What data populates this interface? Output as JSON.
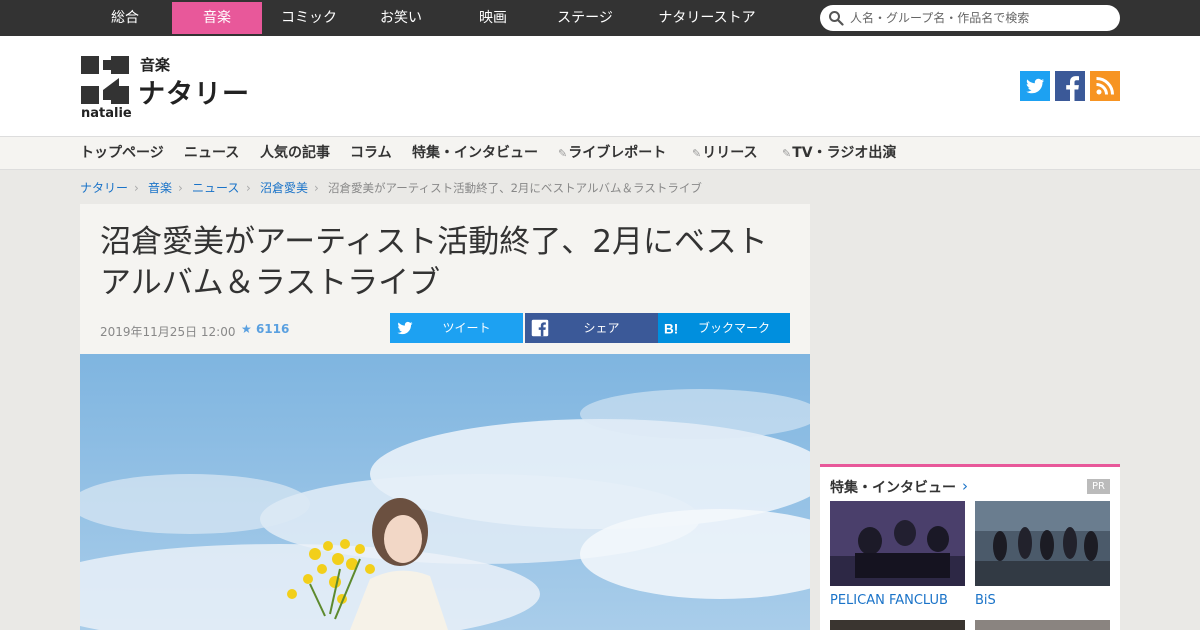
{
  "top_nav": {
    "categories": [
      {
        "label": "総合",
        "active": false
      },
      {
        "label": "音楽",
        "active": true
      },
      {
        "label": "コミック",
        "active": false
      },
      {
        "label": "お笑い",
        "active": false
      },
      {
        "label": "映画",
        "active": false
      },
      {
        "label": "ステージ",
        "active": false
      },
      {
        "label": "ナタリーストア",
        "active": false
      }
    ],
    "search_placeholder": "人名・グループ名・作品名で検索",
    "active_color": "#e8589a"
  },
  "header": {
    "logo_sub": "音楽",
    "logo_main": "ナタリー",
    "logo_en": "natalie",
    "social_icons": [
      "twitter-icon",
      "facebook-icon",
      "rss-icon"
    ]
  },
  "section_nav": {
    "items": [
      {
        "label": "トップページ",
        "pen": false
      },
      {
        "label": "ニュース",
        "pen": false
      },
      {
        "label": "人気の記事",
        "pen": false
      },
      {
        "label": "コラム",
        "pen": false
      },
      {
        "label": "特集・インタビュー",
        "pen": false
      },
      {
        "label": "ライブレポート",
        "pen": true
      },
      {
        "label": "リリース",
        "pen": true
      },
      {
        "label": "TV・ラジオ出演",
        "pen": true
      }
    ]
  },
  "breadcrumb": [
    "ナタリー",
    "音楽",
    "ニュース",
    "沼倉愛美",
    "沼倉愛美がアーティスト活動終了、2月にベストアルバム＆ラストライブ"
  ],
  "article": {
    "title": "沼倉愛美がアーティスト活動終了、2月にベストアルバム＆ラストライブ",
    "date": "2019年11月25日 12:00",
    "star_count": "6116",
    "share_buttons": {
      "tweet": "ツイート",
      "share": "シェア",
      "bookmark": "ブックマーク"
    }
  },
  "sidebar": {
    "title": "特集・インタビュー",
    "pr_label": "PR",
    "items": [
      {
        "label": "PELICAN FANCLUB"
      },
      {
        "label": "BiS"
      }
    ]
  }
}
